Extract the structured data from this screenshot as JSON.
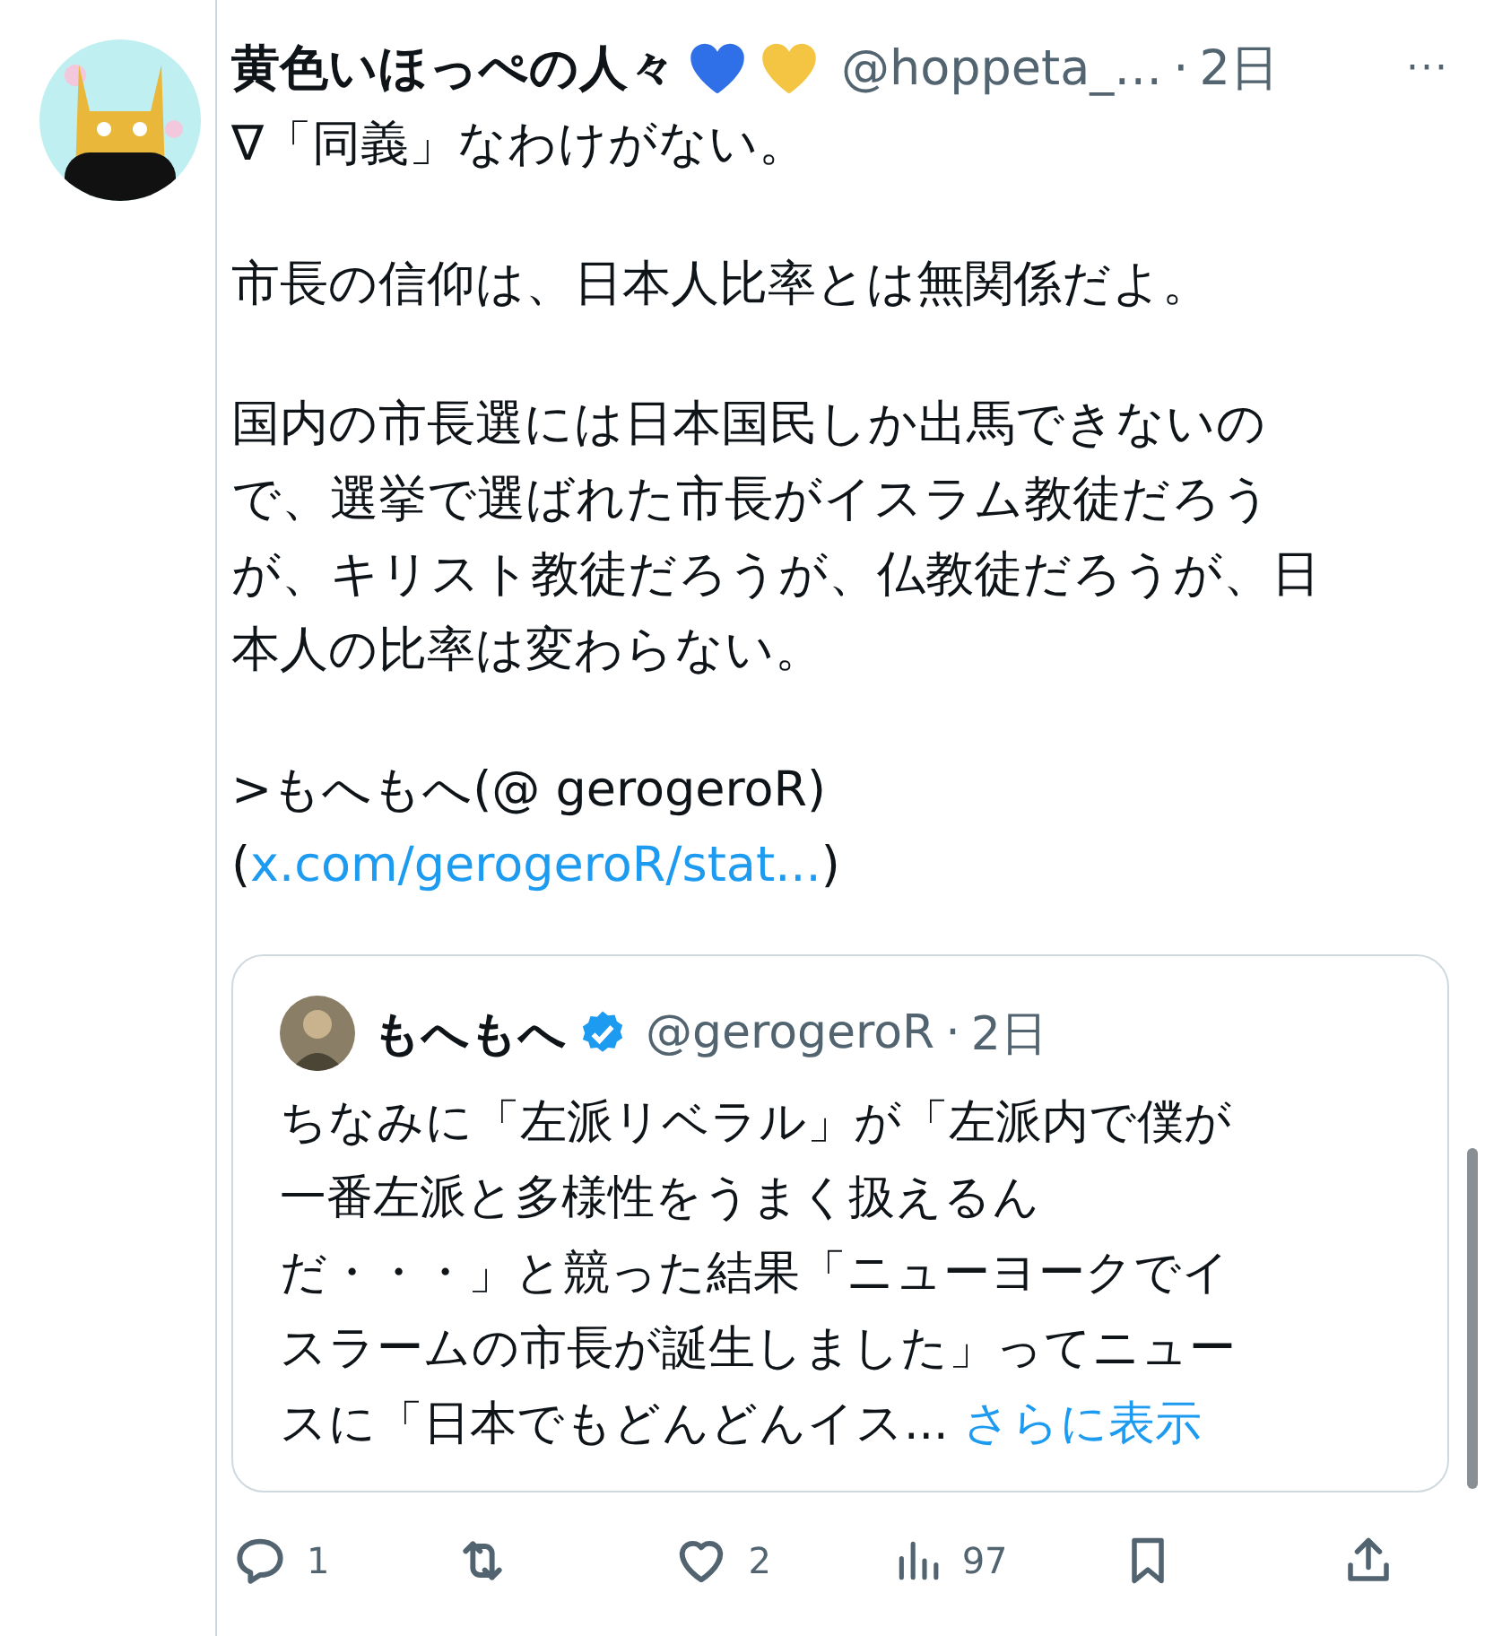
{
  "post": {
    "display_name": "黄色いほっぺの人々",
    "badges": [
      {
        "color": "#2f6fe8"
      },
      {
        "color": "#f4c542"
      }
    ],
    "handle": "@hoppeta_…",
    "separator": "·",
    "time": "2日",
    "more": "···",
    "paragraphs": [
      [
        "∇「同義」なわけがない。"
      ],
      [
        "市長の信仰は、日本人比率とは無関係だよ。"
      ],
      [
        "国内の市長選には日本国民しか出馬できないの",
        "で、選挙で選ばれた市長がイスラム教徒だろう",
        "が、キリスト教徒だろうが、仏教徒だろうが、日",
        "本人の比率は変わらない。"
      ]
    ],
    "reference": {
      "text": ">もへもへ(@ gerogeroR)\n(",
      "link": "x.com/gerogeroR/stat...",
      "after": ")"
    },
    "quote": {
      "display_name": "もへもへ",
      "verified": true,
      "handle": "@gerogeroR",
      "separator": "·",
      "time": "2日",
      "lines": [
        "ちなみに「左派リベラル」が「左派内で僕が",
        "一番左派と多様性をうまく扱えるん",
        "だ・・・」と競った結果「ニューヨークでイ",
        "スラームの市長が誕生しました」ってニュー",
        "スに「日本でもどんどんイス... "
      ],
      "show_more": "さらに表示"
    },
    "actions": [
      {
        "kind": "reply",
        "count": "1"
      },
      {
        "kind": "repost"
      },
      {
        "kind": "like",
        "count": "2"
      },
      {
        "kind": "views",
        "count": "97"
      },
      {
        "kind": "bookmark"
      },
      {
        "kind": "share"
      }
    ]
  }
}
